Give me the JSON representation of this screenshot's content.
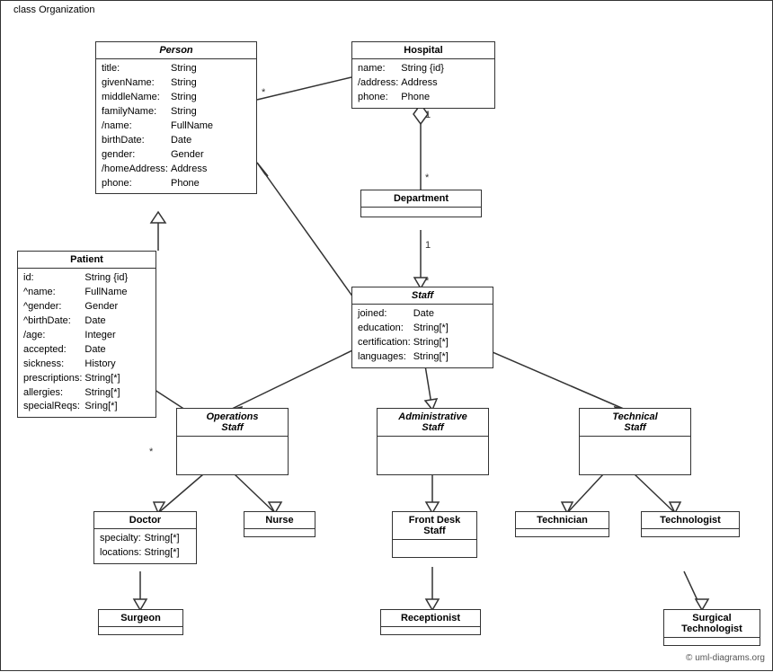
{
  "diagram": {
    "title": "class Organization",
    "classes": {
      "person": {
        "name": "Person",
        "italic": true,
        "attributes": [
          {
            "name": "title:",
            "type": "String"
          },
          {
            "name": "givenName:",
            "type": "String"
          },
          {
            "name": "middleName:",
            "type": "String"
          },
          {
            "name": "familyName:",
            "type": "String"
          },
          {
            "name": "/name:",
            "type": "FullName"
          },
          {
            "name": "birthDate:",
            "type": "Date"
          },
          {
            "name": "gender:",
            "type": "Gender"
          },
          {
            "name": "/homeAddress:",
            "type": "Address"
          },
          {
            "name": "phone:",
            "type": "Phone"
          }
        ]
      },
      "hospital": {
        "name": "Hospital",
        "italic": false,
        "attributes": [
          {
            "name": "name:",
            "type": "String {id}"
          },
          {
            "name": "/address:",
            "type": "Address"
          },
          {
            "name": "phone:",
            "type": "Phone"
          }
        ]
      },
      "department": {
        "name": "Department",
        "italic": false,
        "attributes": []
      },
      "staff": {
        "name": "Staff",
        "italic": true,
        "attributes": [
          {
            "name": "joined:",
            "type": "Date"
          },
          {
            "name": "education:",
            "type": "String[*]"
          },
          {
            "name": "certification:",
            "type": "String[*]"
          },
          {
            "name": "languages:",
            "type": "String[*]"
          }
        ]
      },
      "patient": {
        "name": "Patient",
        "italic": false,
        "attributes": [
          {
            "name": "id:",
            "type": "String {id}"
          },
          {
            "name": "^name:",
            "type": "FullName"
          },
          {
            "name": "^gender:",
            "type": "Gender"
          },
          {
            "name": "^birthDate:",
            "type": "Date"
          },
          {
            "name": "/age:",
            "type": "Integer"
          },
          {
            "name": "accepted:",
            "type": "Date"
          },
          {
            "name": "sickness:",
            "type": "History"
          },
          {
            "name": "prescriptions:",
            "type": "String[*]"
          },
          {
            "name": "allergies:",
            "type": "String[*]"
          },
          {
            "name": "specialReqs:",
            "type": "Sring[*]"
          }
        ]
      },
      "operations_staff": {
        "name": "Operations\nStaff",
        "italic": true,
        "attributes": []
      },
      "administrative_staff": {
        "name": "Administrative\nStaff",
        "italic": true,
        "attributes": []
      },
      "technical_staff": {
        "name": "Technical\nStaff",
        "italic": true,
        "attributes": []
      },
      "doctor": {
        "name": "Doctor",
        "italic": false,
        "attributes": [
          {
            "name": "specialty:",
            "type": "String[*]"
          },
          {
            "name": "locations:",
            "type": "String[*]"
          }
        ]
      },
      "nurse": {
        "name": "Nurse",
        "italic": false,
        "attributes": []
      },
      "front_desk_staff": {
        "name": "Front Desk\nStaff",
        "italic": false,
        "attributes": []
      },
      "technician": {
        "name": "Technician",
        "italic": false,
        "attributes": []
      },
      "technologist": {
        "name": "Technologist",
        "italic": false,
        "attributes": []
      },
      "surgeon": {
        "name": "Surgeon",
        "italic": false,
        "attributes": []
      },
      "receptionist": {
        "name": "Receptionist",
        "italic": false,
        "attributes": []
      },
      "surgical_technologist": {
        "name": "Surgical\nTechnologist",
        "italic": false,
        "attributes": []
      }
    },
    "multiplicity": {
      "hospital_person_star": "*",
      "hospital_department_1": "1",
      "hospital_department_star": "*",
      "department_staff_1": "1",
      "department_staff_star": "*",
      "patient_star": "*",
      "operations_star": "*"
    },
    "copyright": "© uml-diagrams.org"
  }
}
